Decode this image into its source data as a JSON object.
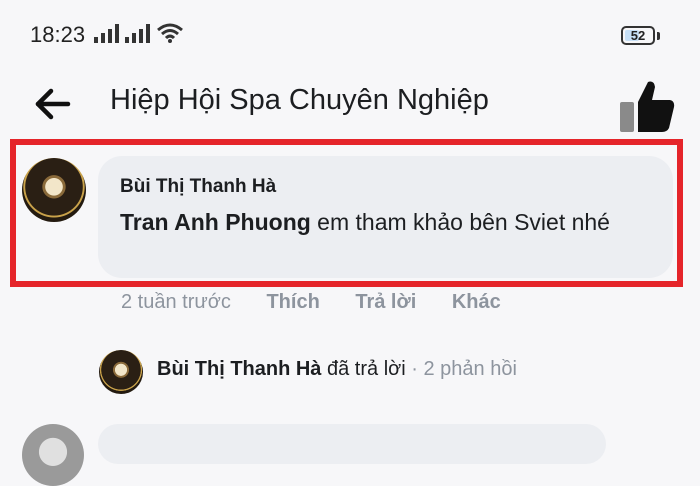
{
  "status_bar": {
    "time": "18:23",
    "battery": "52",
    "battery_level": 0.52
  },
  "header": {
    "back_icon": "back-arrow-icon",
    "title": "Hiệp Hội Spa Chuyên Nghiệp",
    "like_icon": "thumbs-up-icon"
  },
  "comment": {
    "author": "Bùi Thị Thanh Hà",
    "mention": "Tran Anh Phuong",
    "text": " em tham khảo bên Sviet nhé",
    "time": "2 tuần trước",
    "actions": [
      "Thích",
      "Trả lời",
      "Khác"
    ]
  },
  "reply_summary": {
    "name": "Bùi Thị Thanh Hà",
    "verb": " đã trả lời",
    "count": " · 2 phản hồi"
  },
  "colors": {
    "highlight": "#e5252a",
    "bubble": "#eceef2",
    "muted_text": "#8d949e"
  }
}
